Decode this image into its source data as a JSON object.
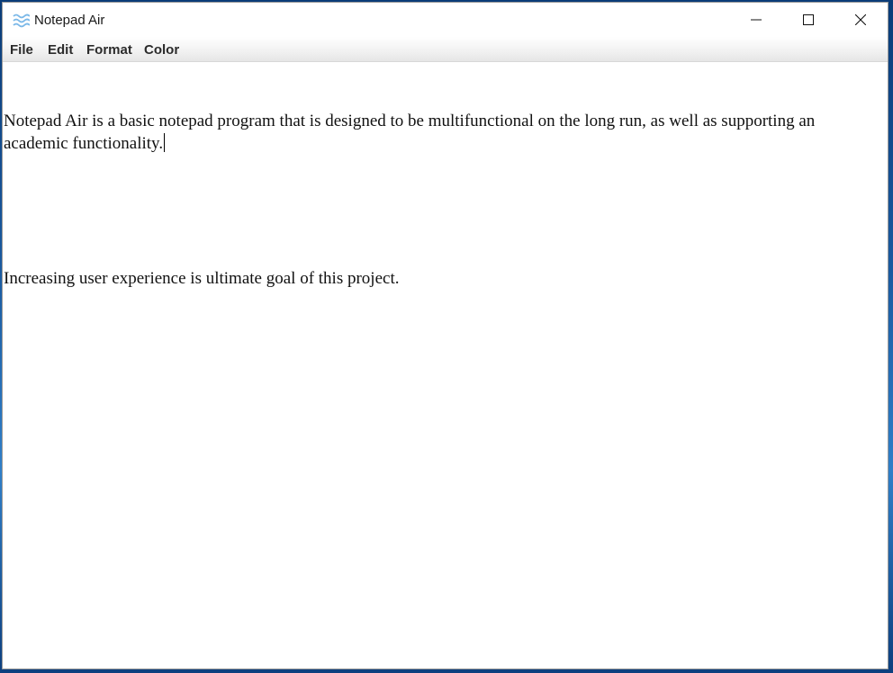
{
  "window": {
    "title": "Notepad Air",
    "icon": "waves-icon",
    "accent_color": "#7ab8e8"
  },
  "controls": {
    "minimize": "minimize-icon",
    "maximize": "maximize-icon",
    "close": "close-icon"
  },
  "menu": {
    "items": [
      {
        "label": "File"
      },
      {
        "label": "Edit"
      },
      {
        "label": "Format"
      },
      {
        "label": "Color"
      }
    ]
  },
  "editor": {
    "paragraphs": [
      "Notepad Air is a basic notepad program that is designed to be multifunctional on the long run, as well as supporting an academic functionality.",
      "Increasing user experience is ultimate goal of this project."
    ]
  }
}
